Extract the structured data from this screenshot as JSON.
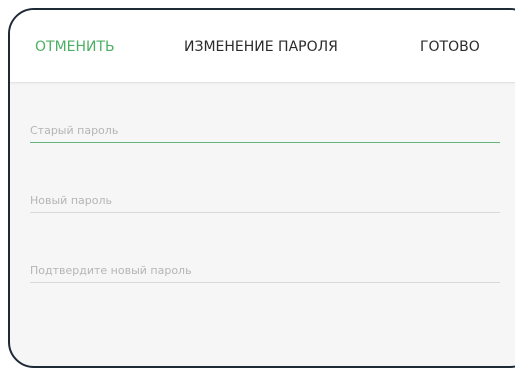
{
  "header": {
    "cancel_label": "ОТМЕНИТЬ",
    "title": "ИЗМЕНЕНИЕ ПАРОЛЯ",
    "done_label": "ГОТОВО"
  },
  "form": {
    "old_password": {
      "placeholder": "Старый пароль",
      "value": ""
    },
    "new_password": {
      "placeholder": "Новый пароль",
      "value": ""
    },
    "confirm_password": {
      "placeholder": "Подтвердите новый пароль",
      "value": ""
    }
  },
  "colors": {
    "accent": "#4caf62",
    "frame": "#1f2a37",
    "background": "#f6f6f6"
  }
}
